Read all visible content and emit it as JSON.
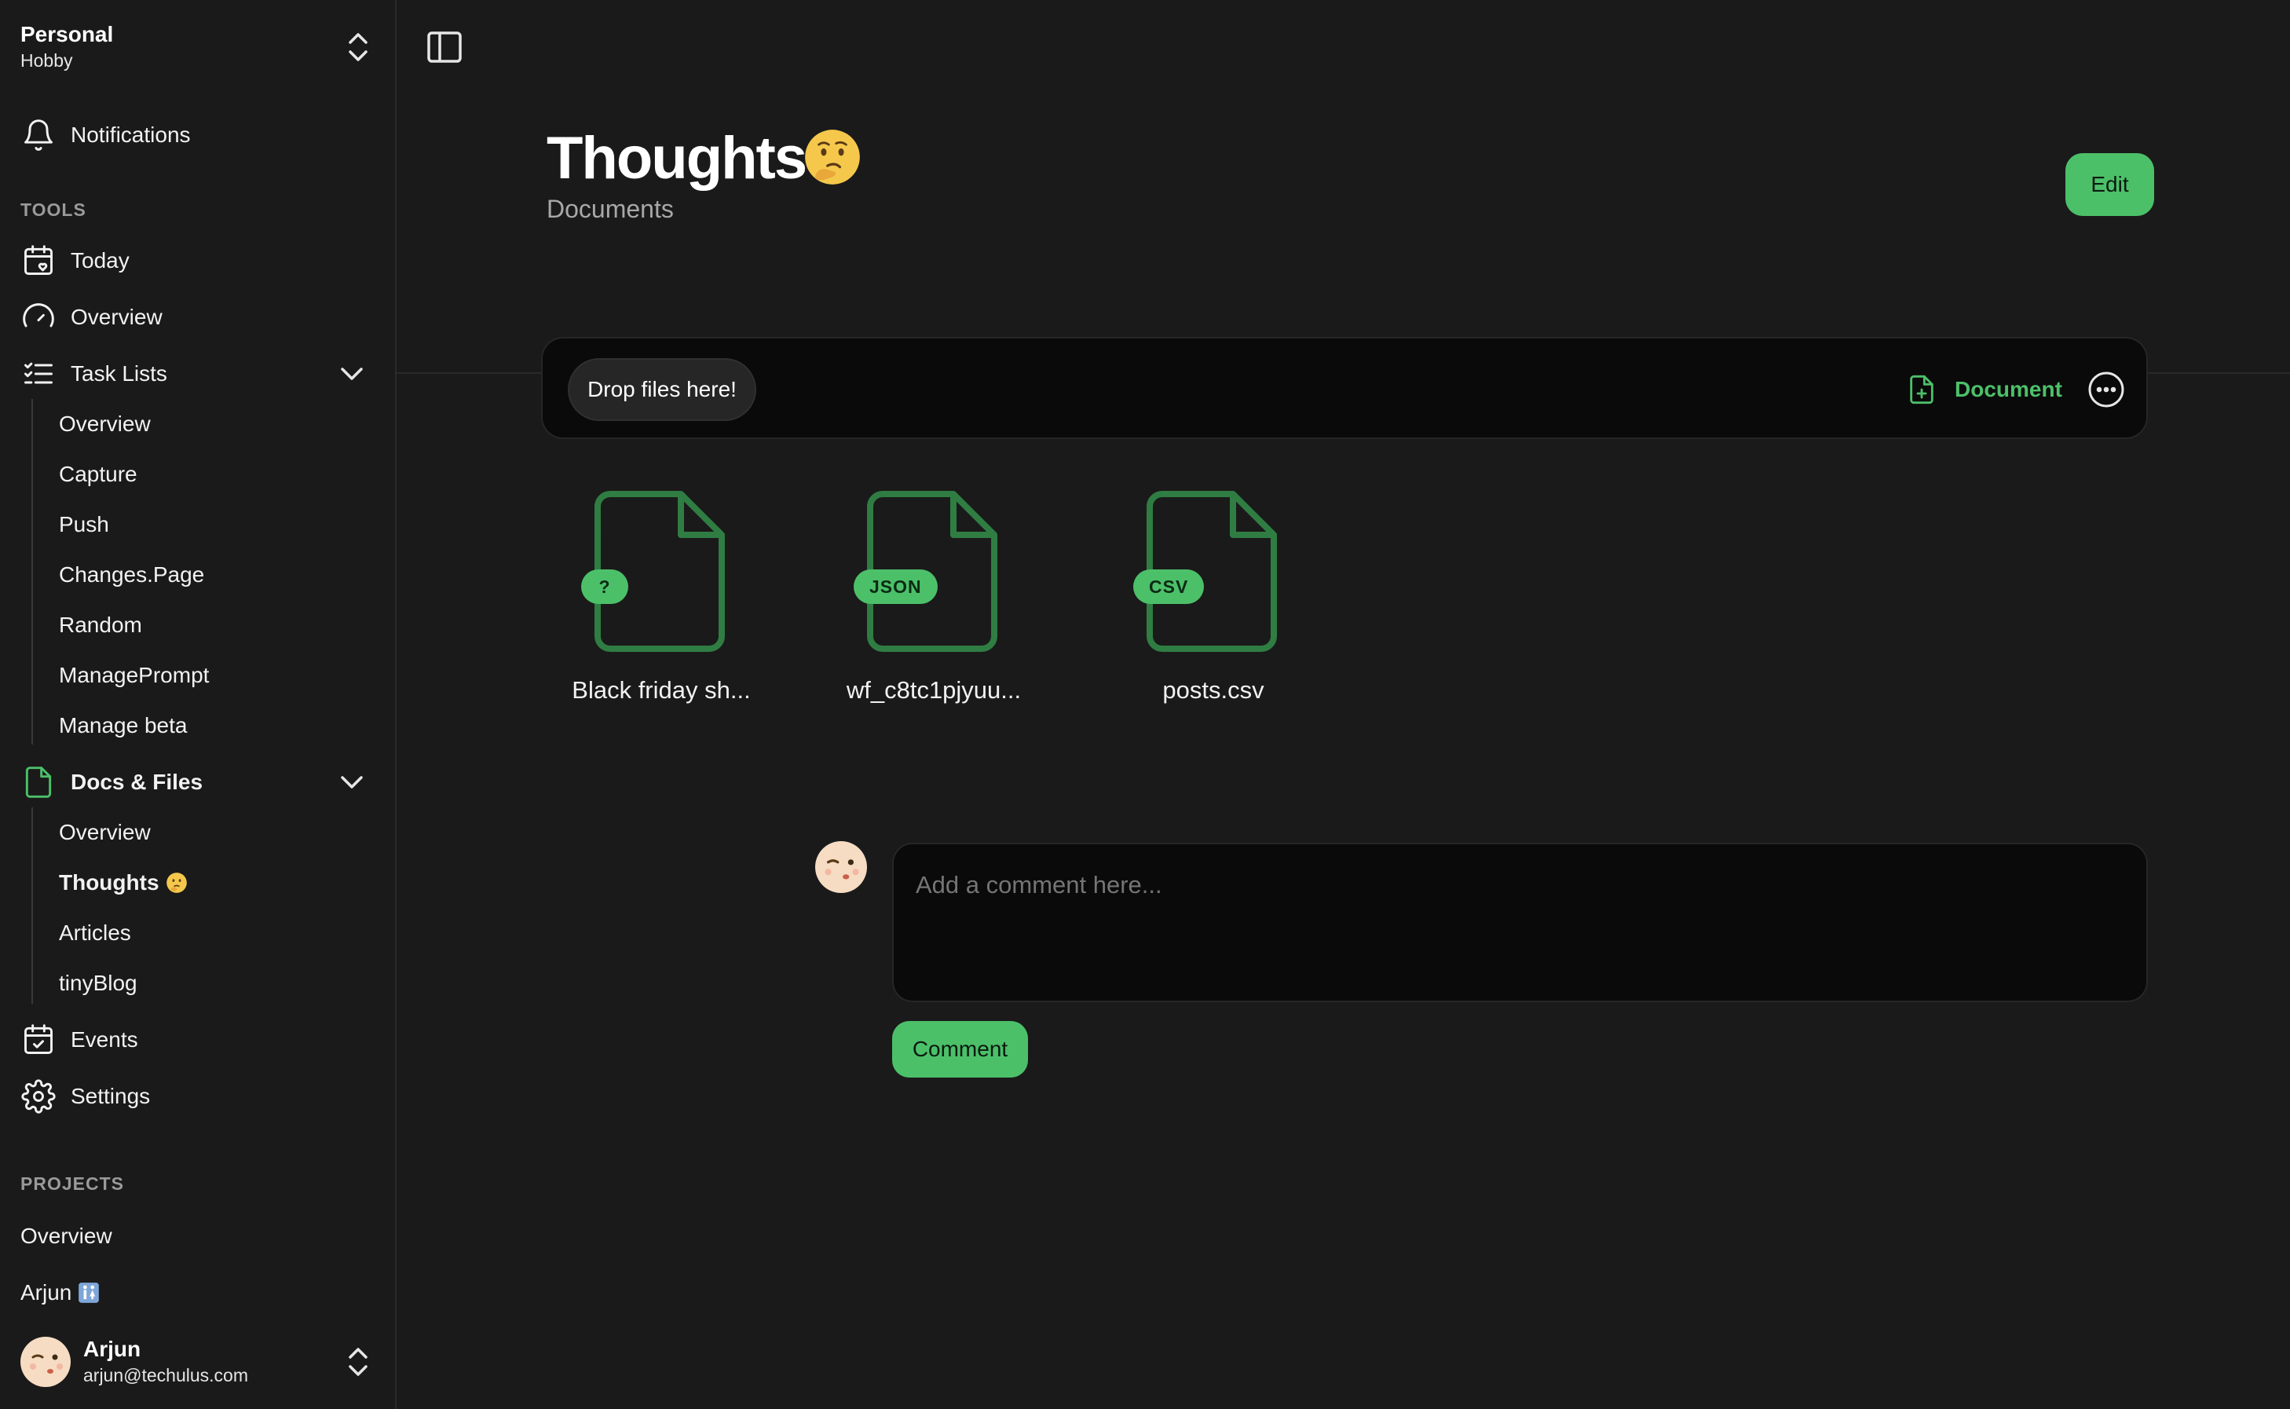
{
  "workspace": {
    "name": "Personal",
    "plan": "Hobby"
  },
  "sidebar": {
    "notifications": "Notifications",
    "tools_title": "TOOLS",
    "today": "Today",
    "overview": "Overview",
    "task_lists": {
      "label": "Task Lists",
      "items": [
        "Overview",
        "Capture",
        "Push",
        "Changes.Page",
        "Random",
        "ManagePrompt",
        "Manage beta"
      ]
    },
    "docs_files": {
      "label": "Docs & Files",
      "items": [
        "Overview",
        "Thoughts",
        "Articles",
        "tinyBlog"
      ],
      "active": "Thoughts"
    },
    "events": "Events",
    "settings": "Settings",
    "projects_title": "PROJECTS",
    "projects": [
      "Overview",
      "Arjun"
    ]
  },
  "user": {
    "name": "Arjun",
    "email": "arjun@techulus.com"
  },
  "page": {
    "title": "Thoughts",
    "subtitle": "Documents",
    "edit_label": "Edit"
  },
  "dropbar": {
    "drop_label": "Drop files here!",
    "document_label": "Document"
  },
  "files": [
    {
      "badge": "?",
      "name": "Black friday sh..."
    },
    {
      "badge": "JSON",
      "name": "wf_c8tc1pjyuu..."
    },
    {
      "badge": "CSV",
      "name": "posts.csv"
    }
  ],
  "comment": {
    "placeholder": "Add a comment here...",
    "button_label": "Comment"
  },
  "colors": {
    "accent": "#4cc069",
    "background": "#1a1a1a",
    "panel": "#0a0a0a"
  }
}
